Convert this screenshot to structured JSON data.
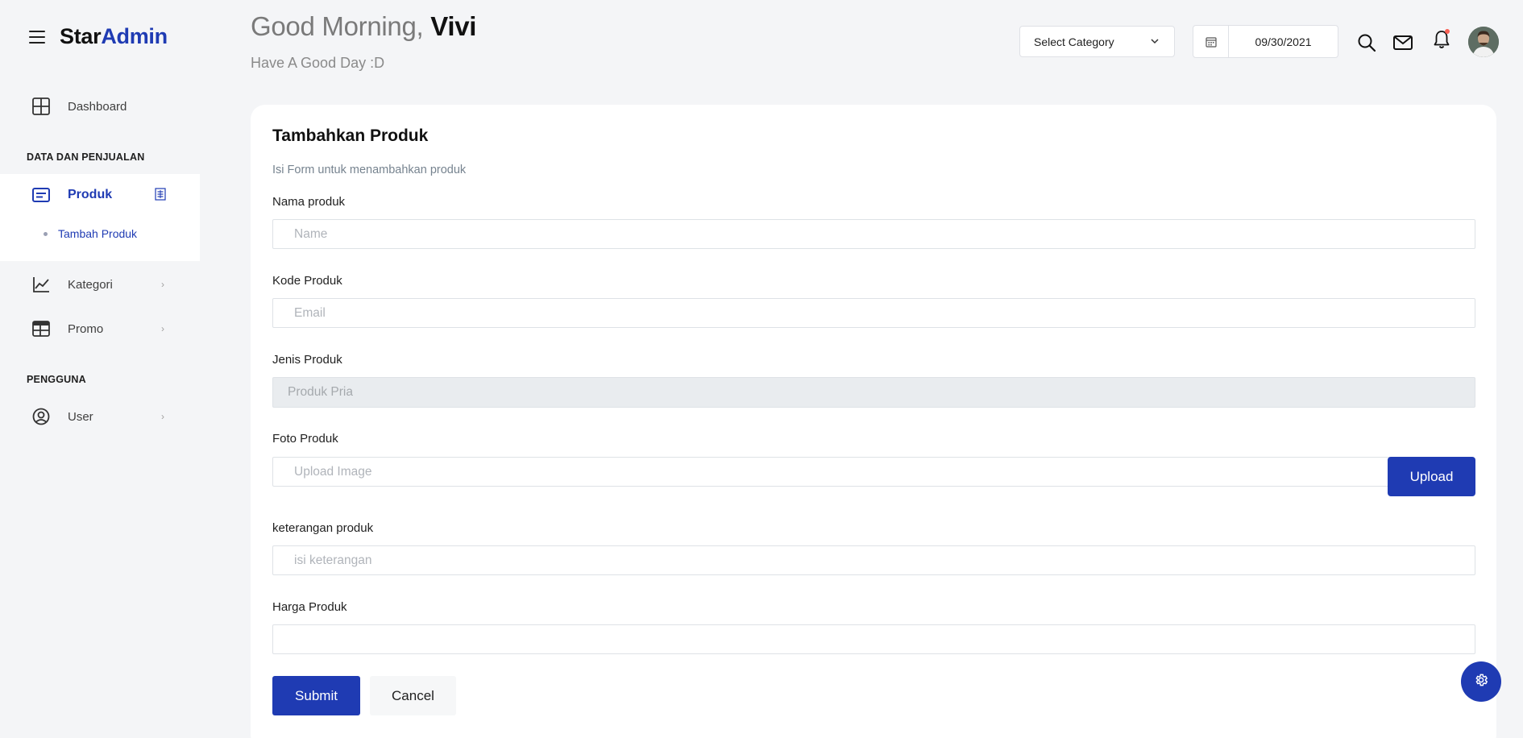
{
  "brand": {
    "star": "Star",
    "admin": "Admin"
  },
  "sidebar": {
    "dashboard": "Dashboard",
    "section_sales": "DATA DAN PENJUALAN",
    "produk": "Produk",
    "tambah_produk": "Tambah Produk",
    "kategori": "Kategori",
    "promo": "Promo",
    "section_users": "PENGGUNA",
    "user": "User",
    "arrow": "›"
  },
  "header": {
    "greeting": "Good Morning,",
    "name": "Vivi",
    "subtitle": "Have A Good Day :D",
    "category_select": "Select Category",
    "date": "09/30/2021"
  },
  "form": {
    "title": "Tambahkan Produk",
    "description": "Isi Form untuk menambahkan produk",
    "nama_label": "Nama produk",
    "nama_placeholder": "Name",
    "kode_label": "Kode Produk",
    "kode_placeholder": "Email",
    "jenis_label": "Jenis Produk",
    "jenis_value": "Produk Pria",
    "foto_label": "Foto Produk",
    "foto_placeholder": "Upload Image",
    "upload_button": "Upload",
    "keterangan_label": "keterangan produk",
    "keterangan_placeholder": "isi keterangan",
    "harga_label": "Harga Produk",
    "harga_value": "",
    "submit_button": "Submit",
    "cancel_button": "Cancel"
  },
  "colors": {
    "primary": "#1f3bb3",
    "background": "#f4f5f7",
    "notification_dot": "#f95f53"
  },
  "icons": {
    "hamburger": "menu-icon",
    "dashboard": "grid-icon",
    "produk": "card-text-icon",
    "kategori": "chart-line-icon",
    "promo": "table-icon",
    "user": "account-circle-icon",
    "search": "search-icon",
    "mail": "mail-icon",
    "bell": "bell-icon",
    "calendar": "calendar-icon",
    "settings": "gear-icon"
  }
}
